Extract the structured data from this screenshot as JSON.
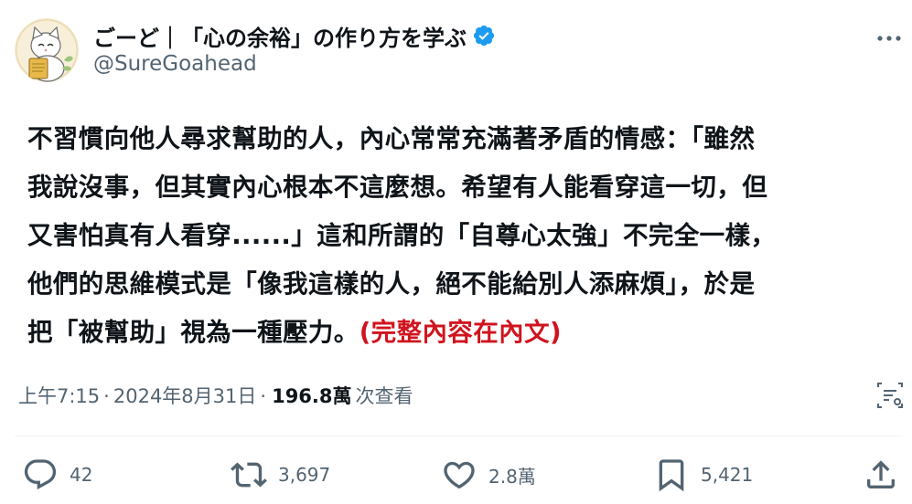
{
  "author": {
    "display_name": "ごーど｜「心の余裕」の作り方を学ぶ",
    "handle": "@SureGoahead",
    "avatar_icon": "cat-avatar-icon",
    "verified_icon": "verified-badge-icon"
  },
  "tweet": {
    "lines": [
      "不習慣向他人尋求幫助的人，內心常常充滿著矛盾的情感：「雖然",
      "我說沒事，但其實內心根本不這麼想。希望有人能看穿這一切，但",
      "又害怕真有人看穿......」這和所謂的「自尊心太強」不完全一樣，",
      "他們的思維模式是「像我這樣的人，絕不能給別人添麻煩」，於是",
      "把「被幫助」視為一種壓力。"
    ],
    "read_more": "(完整內容在內文)"
  },
  "meta": {
    "time": "上午7:15",
    "separator": "·",
    "date": "2024年8月31日",
    "views_count": "196.8萬",
    "views_label": "次查看"
  },
  "actions": {
    "replies": "42",
    "reposts": "3,697",
    "likes": "2.8萬",
    "bookmarks": "5,421"
  },
  "colors": {
    "text": "#0f1419",
    "secondary": "#536471",
    "verified": "#1d9bf0",
    "read_more": "#d0141f"
  }
}
